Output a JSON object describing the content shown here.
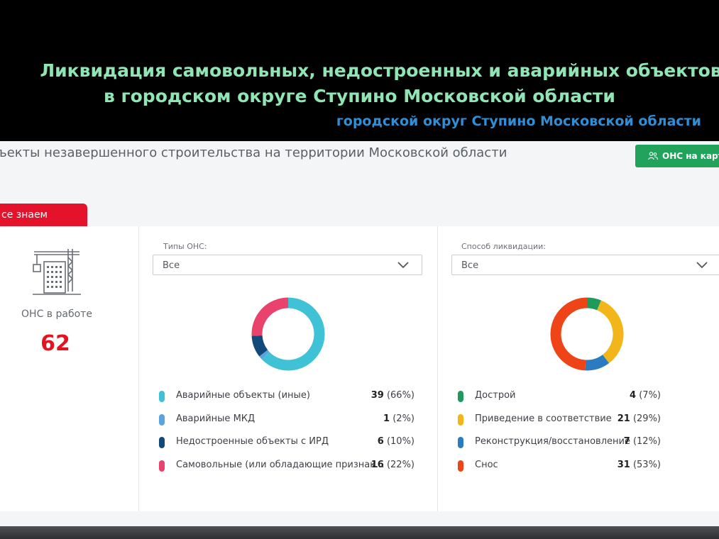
{
  "slide": {
    "title_line1": "Ликвидация самовольных, недостроенных и аварийных объектов",
    "title_line2": "в городском округе Ступино Московской области",
    "subtitle": "городской округ Ступино Московской области"
  },
  "header": {
    "page_title": "ъекты незавершенного строительства на территории Московской области",
    "map_button": "ОНС на карте"
  },
  "tab": {
    "label": "се знаем"
  },
  "summary": {
    "icon": "crane-building-icon",
    "label": "ОНС в работе",
    "value": "62"
  },
  "types_panel": {
    "filter_label": "Типы ОНС:",
    "filter_value": "Все",
    "chart_data": {
      "type": "pie",
      "values": [
        39,
        1,
        6,
        16
      ],
      "categories": [
        "Аварийные объекты (иные)",
        "Аварийные МКД",
        "Недостроенные объекты с ИРД",
        "Самовольные (или обладающие признак..."
      ],
      "colors": [
        "#3fc1d6",
        "#5ba3dc",
        "#114a7a",
        "#e8426d"
      ]
    },
    "legend": [
      {
        "label": "Аварийные объекты (иные)",
        "count": "39",
        "pct": "(66%)",
        "color": "#3fc1d6"
      },
      {
        "label": "Аварийные МКД",
        "count": "1",
        "pct": "(2%)",
        "color": "#5ba3dc"
      },
      {
        "label": "Недостроенные объекты с ИРД",
        "count": "6",
        "pct": "(10%)",
        "color": "#114a7a"
      },
      {
        "label": "Самовольные (или обладающие признак...",
        "count": "16",
        "pct": "(22%)",
        "color": "#e8426d"
      }
    ]
  },
  "method_panel": {
    "filter_label": "Способ ликвидации:",
    "filter_value": "Все",
    "chart_data": {
      "type": "pie",
      "values": [
        4,
        21,
        7,
        31
      ],
      "categories": [
        "Дострой",
        "Приведение в соответствие",
        "Реконструкция/восстановление",
        "Снос"
      ],
      "colors": [
        "#1f9a5b",
        "#f2b61b",
        "#2a7bbf",
        "#ef4418"
      ]
    },
    "legend": [
      {
        "label": "Дострой",
        "count": "4",
        "pct": "(7%)",
        "color": "#1f9a5b"
      },
      {
        "label": "Приведение в соответствие",
        "count": "21",
        "pct": "(29%)",
        "color": "#f2b61b"
      },
      {
        "label": "Реконструкция/восстановление",
        "count": "7",
        "pct": "(12%)",
        "color": "#2a7bbf"
      },
      {
        "label": "Снос",
        "count": "31",
        "pct": "(53%)",
        "color": "#ef4418"
      }
    ]
  }
}
